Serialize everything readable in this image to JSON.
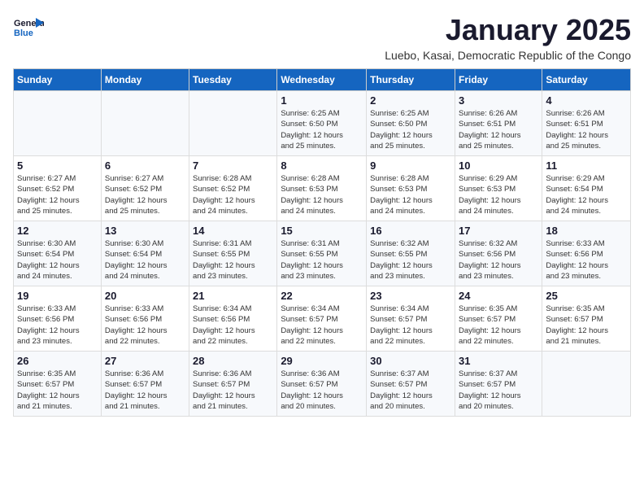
{
  "header": {
    "logo_general": "General",
    "logo_blue": "Blue",
    "month": "January 2025",
    "location": "Luebo, Kasai, Democratic Republic of the Congo"
  },
  "days_of_week": [
    "Sunday",
    "Monday",
    "Tuesday",
    "Wednesday",
    "Thursday",
    "Friday",
    "Saturday"
  ],
  "weeks": [
    [
      {
        "day": "",
        "info": ""
      },
      {
        "day": "",
        "info": ""
      },
      {
        "day": "",
        "info": ""
      },
      {
        "day": "1",
        "info": "Sunrise: 6:25 AM\nSunset: 6:50 PM\nDaylight: 12 hours\nand 25 minutes."
      },
      {
        "day": "2",
        "info": "Sunrise: 6:25 AM\nSunset: 6:50 PM\nDaylight: 12 hours\nand 25 minutes."
      },
      {
        "day": "3",
        "info": "Sunrise: 6:26 AM\nSunset: 6:51 PM\nDaylight: 12 hours\nand 25 minutes."
      },
      {
        "day": "4",
        "info": "Sunrise: 6:26 AM\nSunset: 6:51 PM\nDaylight: 12 hours\nand 25 minutes."
      }
    ],
    [
      {
        "day": "5",
        "info": "Sunrise: 6:27 AM\nSunset: 6:52 PM\nDaylight: 12 hours\nand 25 minutes."
      },
      {
        "day": "6",
        "info": "Sunrise: 6:27 AM\nSunset: 6:52 PM\nDaylight: 12 hours\nand 25 minutes."
      },
      {
        "day": "7",
        "info": "Sunrise: 6:28 AM\nSunset: 6:52 PM\nDaylight: 12 hours\nand 24 minutes."
      },
      {
        "day": "8",
        "info": "Sunrise: 6:28 AM\nSunset: 6:53 PM\nDaylight: 12 hours\nand 24 minutes."
      },
      {
        "day": "9",
        "info": "Sunrise: 6:28 AM\nSunset: 6:53 PM\nDaylight: 12 hours\nand 24 minutes."
      },
      {
        "day": "10",
        "info": "Sunrise: 6:29 AM\nSunset: 6:53 PM\nDaylight: 12 hours\nand 24 minutes."
      },
      {
        "day": "11",
        "info": "Sunrise: 6:29 AM\nSunset: 6:54 PM\nDaylight: 12 hours\nand 24 minutes."
      }
    ],
    [
      {
        "day": "12",
        "info": "Sunrise: 6:30 AM\nSunset: 6:54 PM\nDaylight: 12 hours\nand 24 minutes."
      },
      {
        "day": "13",
        "info": "Sunrise: 6:30 AM\nSunset: 6:54 PM\nDaylight: 12 hours\nand 24 minutes."
      },
      {
        "day": "14",
        "info": "Sunrise: 6:31 AM\nSunset: 6:55 PM\nDaylight: 12 hours\nand 23 minutes."
      },
      {
        "day": "15",
        "info": "Sunrise: 6:31 AM\nSunset: 6:55 PM\nDaylight: 12 hours\nand 23 minutes."
      },
      {
        "day": "16",
        "info": "Sunrise: 6:32 AM\nSunset: 6:55 PM\nDaylight: 12 hours\nand 23 minutes."
      },
      {
        "day": "17",
        "info": "Sunrise: 6:32 AM\nSunset: 6:56 PM\nDaylight: 12 hours\nand 23 minutes."
      },
      {
        "day": "18",
        "info": "Sunrise: 6:33 AM\nSunset: 6:56 PM\nDaylight: 12 hours\nand 23 minutes."
      }
    ],
    [
      {
        "day": "19",
        "info": "Sunrise: 6:33 AM\nSunset: 6:56 PM\nDaylight: 12 hours\nand 23 minutes."
      },
      {
        "day": "20",
        "info": "Sunrise: 6:33 AM\nSunset: 6:56 PM\nDaylight: 12 hours\nand 22 minutes."
      },
      {
        "day": "21",
        "info": "Sunrise: 6:34 AM\nSunset: 6:56 PM\nDaylight: 12 hours\nand 22 minutes."
      },
      {
        "day": "22",
        "info": "Sunrise: 6:34 AM\nSunset: 6:57 PM\nDaylight: 12 hours\nand 22 minutes."
      },
      {
        "day": "23",
        "info": "Sunrise: 6:34 AM\nSunset: 6:57 PM\nDaylight: 12 hours\nand 22 minutes."
      },
      {
        "day": "24",
        "info": "Sunrise: 6:35 AM\nSunset: 6:57 PM\nDaylight: 12 hours\nand 22 minutes."
      },
      {
        "day": "25",
        "info": "Sunrise: 6:35 AM\nSunset: 6:57 PM\nDaylight: 12 hours\nand 21 minutes."
      }
    ],
    [
      {
        "day": "26",
        "info": "Sunrise: 6:35 AM\nSunset: 6:57 PM\nDaylight: 12 hours\nand 21 minutes."
      },
      {
        "day": "27",
        "info": "Sunrise: 6:36 AM\nSunset: 6:57 PM\nDaylight: 12 hours\nand 21 minutes."
      },
      {
        "day": "28",
        "info": "Sunrise: 6:36 AM\nSunset: 6:57 PM\nDaylight: 12 hours\nand 21 minutes."
      },
      {
        "day": "29",
        "info": "Sunrise: 6:36 AM\nSunset: 6:57 PM\nDaylight: 12 hours\nand 20 minutes."
      },
      {
        "day": "30",
        "info": "Sunrise: 6:37 AM\nSunset: 6:57 PM\nDaylight: 12 hours\nand 20 minutes."
      },
      {
        "day": "31",
        "info": "Sunrise: 6:37 AM\nSunset: 6:57 PM\nDaylight: 12 hours\nand 20 minutes."
      },
      {
        "day": "",
        "info": ""
      }
    ]
  ]
}
